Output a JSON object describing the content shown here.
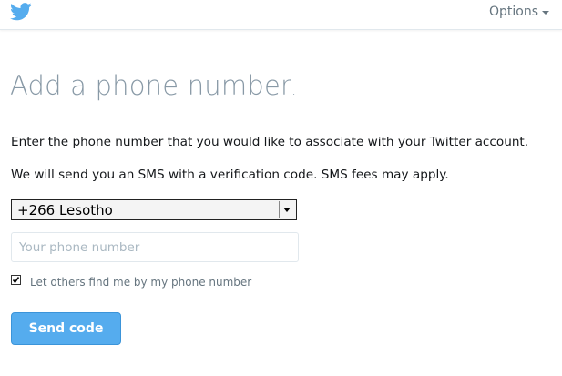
{
  "header": {
    "logo_icon": "twitter-bird-icon",
    "options_label": "Options",
    "options_icon": "caret-down-icon"
  },
  "main": {
    "title": "Add a phone number",
    "title_period": ".",
    "description_1": "Enter the phone number that you would like to associate with your Twitter account.",
    "description_2": "We will send you an SMS with a verification code. SMS fees may apply.",
    "country_select": {
      "selected": "+266 Lesotho"
    },
    "phone_input": {
      "value": "",
      "placeholder": "Your phone number"
    },
    "discoverable_checkbox": {
      "checked": true,
      "label": "Let others find me by my phone number"
    },
    "send_button_label": "Send code"
  },
  "colors": {
    "twitter_blue": "#55acee",
    "title_gray": "#8899a6",
    "muted_text": "#66757f"
  }
}
